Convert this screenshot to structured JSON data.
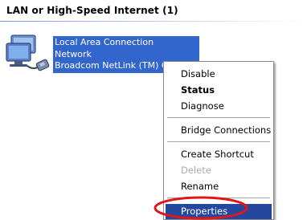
{
  "group": {
    "title": "LAN or High-Speed Internet (1)"
  },
  "connection": {
    "icon": "network-connection-icon",
    "name": "Local Area Connection",
    "type": "Network",
    "device": "Broadcom NetLink (TM) G"
  },
  "context_menu": {
    "items": [
      {
        "label": "Disable",
        "bold": false,
        "disabled": false
      },
      {
        "label": "Status",
        "bold": true,
        "disabled": false
      },
      {
        "label": "Diagnose",
        "bold": false,
        "disabled": false
      },
      {
        "label": "Bridge Connections",
        "bold": false,
        "disabled": false
      },
      {
        "label": "Create Shortcut",
        "bold": false,
        "disabled": false
      },
      {
        "label": "Delete",
        "bold": false,
        "disabled": true
      },
      {
        "label": "Rename",
        "bold": false,
        "disabled": false
      },
      {
        "label": "Properties",
        "bold": false,
        "disabled": false,
        "highlighted": true
      }
    ]
  },
  "colors": {
    "selection": "#3366cc",
    "menu_highlight": "#24489e",
    "annotation": "#e0161b"
  }
}
